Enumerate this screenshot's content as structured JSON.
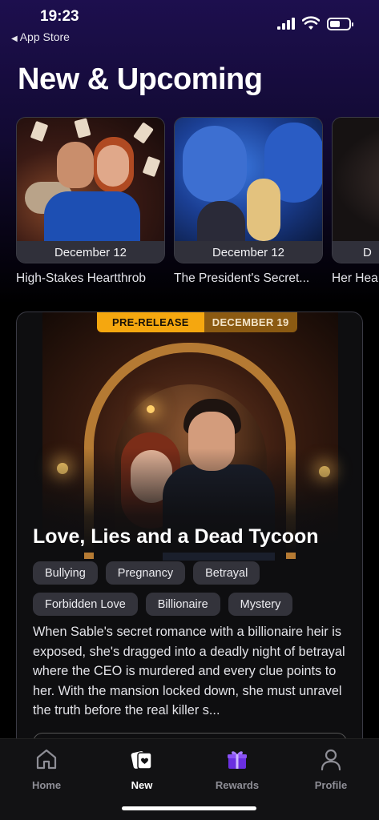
{
  "status_bar": {
    "time": "19:23",
    "back_label": "App Store"
  },
  "page_title": "New & Upcoming",
  "carousel": [
    {
      "date": "December 12",
      "title": "High-Stakes Heartthrob"
    },
    {
      "date": "December 12",
      "title": "The President's Secret..."
    },
    {
      "date": "D",
      "title": "Her Hea"
    }
  ],
  "feature": {
    "ribbon_label": "PRE-RELEASE",
    "ribbon_date": "DECEMBER 19",
    "title": "Love, Lies and a Dead Tycoon",
    "tags_row1": [
      "Bullying",
      "Pregnancy",
      "Betrayal"
    ],
    "tags_row2": [
      "Forbidden Love",
      "Billionaire",
      "Mystery"
    ],
    "description": "When Sable's secret romance with a billionaire heir is exposed, she's dragged into a deadly night of betrayal where the CEO is murdered and every clue points to her. With the mansion locked down, she must unravel the truth before the real killer s..."
  },
  "tabs": [
    {
      "label": "Home",
      "icon": "home-icon"
    },
    {
      "label": "New",
      "icon": "new-icon"
    },
    {
      "label": "Rewards",
      "icon": "gift-icon"
    },
    {
      "label": "Profile",
      "icon": "profile-icon"
    }
  ],
  "colors": {
    "accent": "#f5a70f",
    "ribbon_date_bg": "#8b5a12",
    "gift": "#7a3cf0"
  }
}
